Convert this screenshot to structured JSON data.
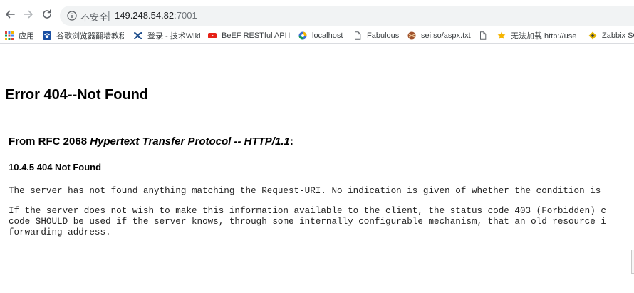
{
  "browser": {
    "security_label": "不安全",
    "separator": "|",
    "url_host": "149.248.54.82",
    "url_port": ":7001"
  },
  "bookmarks": [
    {
      "label": "应用",
      "icon": "apps-grid-icon",
      "color": "#4285f4"
    },
    {
      "label": "谷歌浏览器翻墙教程_",
      "icon": "paw-icon",
      "color": "#1a4fa3"
    },
    {
      "label": "登录 - 技术Wiki",
      "icon": "confluence-x-icon",
      "color": "#1f4e8c"
    },
    {
      "label": "BeEF RESTful API D",
      "icon": "youtube-icon",
      "color": "#e62117"
    },
    {
      "label": "localhost",
      "icon": "browser-logo-icon",
      "color": "#3b6fd1"
    },
    {
      "label": "Fabulous",
      "icon": "page-icon",
      "color": "#5f6368"
    },
    {
      "label": "sei.so/aspx.txt",
      "icon": "chrome-ball-icon",
      "color": "#a0522d"
    },
    {
      "label": "",
      "icon": "page-icon",
      "color": "#5f6368"
    },
    {
      "label": "无法加载 http://user",
      "icon": "star-icon",
      "color": "#f5b400"
    },
    {
      "label": "Zabbix SC",
      "icon": "diamond-icon",
      "color": "#e3b400"
    }
  ],
  "page": {
    "title": "Error 404--Not Found",
    "rfc_prefix": "From RFC 2068 ",
    "rfc_italic": "Hypertext Transfer Protocol -- HTTP/1.1",
    "rfc_suffix": ":",
    "section": "10.4.5 404 Not Found",
    "paragraph1": "The server has not found anything matching the Request-URI. No indication is given of whether the condition is",
    "paragraph2_line1": "If the server does not wish to make this information available to the client, the status code 403 (Forbidden) c",
    "paragraph2_line2": "code SHOULD be used if the server knows, through some internally configurable mechanism, that an old resource i",
    "paragraph2_line3": "forwarding address."
  }
}
